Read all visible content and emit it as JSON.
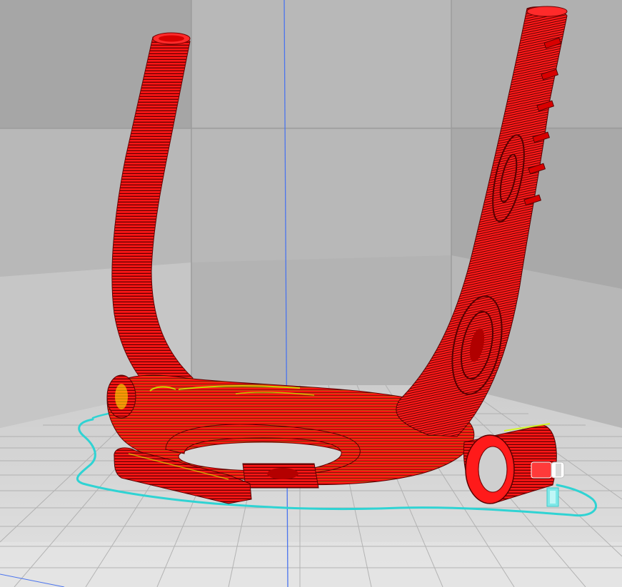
{
  "viewport": {
    "view_mode": "layer-view",
    "colors": {
      "background_top": "#a3a3a3",
      "background_mid": "#b4b4b4",
      "back_wall_light": "#c3c3c3",
      "back_wall_dark": "#9a9a9a",
      "floor_light": "#d9d9d9",
      "floor_dark": "#bebebe",
      "grid_line": "#a8a8a8",
      "axis_line": "#3a6ff0",
      "model_wall": "#ff1010",
      "model_layer_line": "#5a0000",
      "infill": "#c8ff00",
      "travel_line": "#3fd8d8"
    }
  }
}
